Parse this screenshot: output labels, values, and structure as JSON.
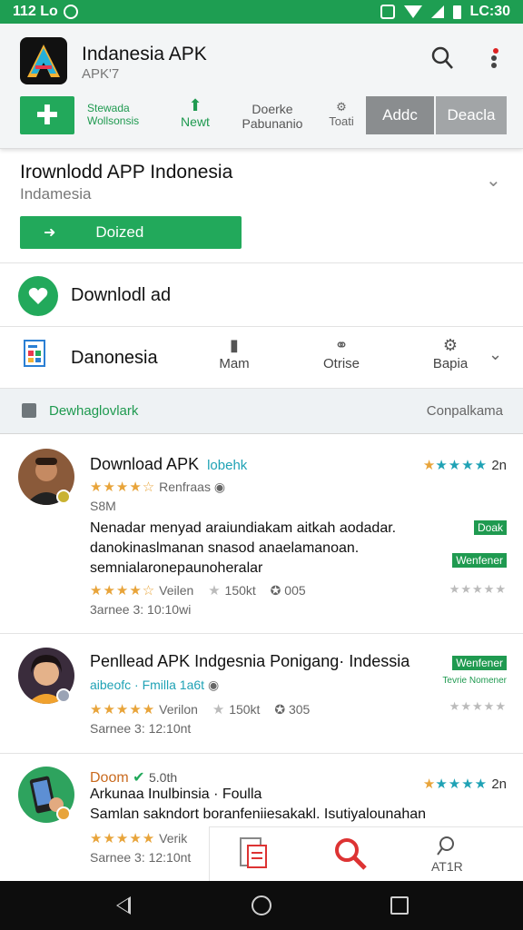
{
  "status_bar": {
    "time": "112 Lo",
    "right_time": "LC:30"
  },
  "header": {
    "title": "Indanesia APK",
    "subtitle": "APK'7",
    "actions": {
      "col1_line1": "Stewada",
      "col1_line2": "Wollsonsis",
      "newt": "Newt",
      "doerke_line1": "Doerke",
      "doerke_line2": "Pabunanio",
      "toati": "Toati",
      "addc": "Addc",
      "deacla": "Deacla"
    }
  },
  "promo": {
    "title": "Irownlodd APP Indonesia",
    "subtitle": "Indamesia",
    "button": "Doized"
  },
  "download_row": {
    "label": "Downlodl ad"
  },
  "category": {
    "name": "Danonesia",
    "items": [
      {
        "label": "Mam"
      },
      {
        "label": "Otrise"
      },
      {
        "label": "Bapia"
      }
    ]
  },
  "filter": {
    "label": "Dewhaglovlark",
    "right": "Conpalkama"
  },
  "listings": [
    {
      "title": "Download APK",
      "tag": "lobehk",
      "stars": "★★★★☆",
      "publisher": "Renfraas",
      "size": "S8M",
      "desc_line1": "Nenadar menyad araiundiakam aitkah aodadar.",
      "desc_line2": "danokinaslmanan snasod anaelamanoan.",
      "desc_line3": "semnialaronepaunoheralar",
      "meta_stars": "★★★★☆",
      "meta_version": "Veilen",
      "meta_downloads": "150kt",
      "meta_count": "005",
      "date": "3arnee 3: 10:10wi",
      "rating_stars": "★★★★",
      "rating_value": "2n",
      "badge1": "Doak",
      "badge2": "Wenfener",
      "mini_stars": "★★★★★"
    },
    {
      "title": "Penllead APK Indgesnia Ponigang· Indessia",
      "subtitle": "aibeofc · Fmilla 1a6t",
      "meta_stars": "★★★★★",
      "meta_version": "Verilon",
      "meta_downloads": "150kt",
      "meta_count": "305",
      "date": "Sarnee 3: 12:10nt",
      "badge1": "Wenfener",
      "badge2": "Tevrie Nomener",
      "mini_stars": "★★★★★"
    },
    {
      "title": "Doom",
      "title_right": "5.0th",
      "title2": "Arkunaa Inulbinsia · Foulla",
      "desc": "Samlan sakndort boranfeniiesakakl. Isutiyalounahan",
      "meta_stars": "★★★★★",
      "meta_version": "Verik",
      "date": "Sarnee 3: 12:10nt",
      "rating_stars": "★★★★",
      "rating_value": "2n"
    }
  ],
  "bottom_tabs": [
    {
      "label": ""
    },
    {
      "label": ""
    },
    {
      "label": "AT1R"
    }
  ]
}
